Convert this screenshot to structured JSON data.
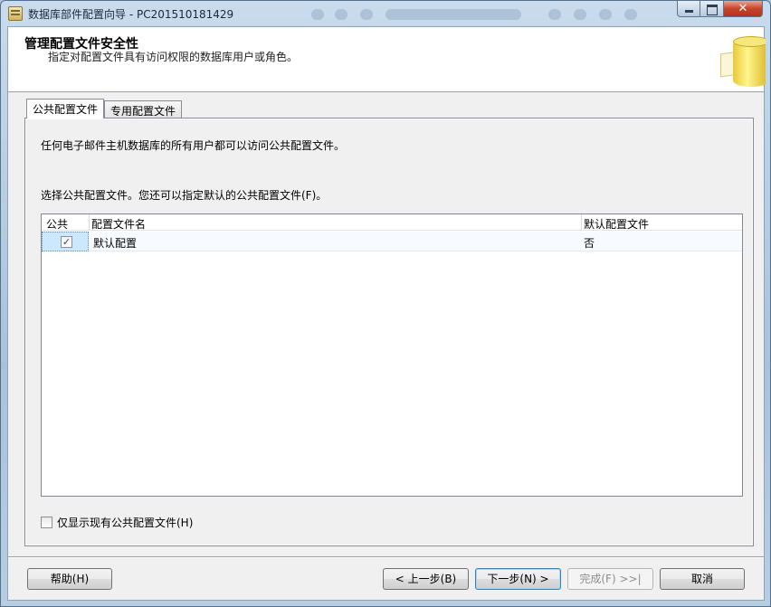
{
  "window": {
    "title": "数据库部件配置向导 - PC201510181429",
    "close_glyph": "✕"
  },
  "header": {
    "title": "管理配置文件安全性",
    "subtitle": "指定对配置文件具有访问权限的数据库用户或角色。"
  },
  "tabs": [
    {
      "label": "公共配置文件",
      "active": true
    },
    {
      "label": "专用配置文件",
      "active": false
    }
  ],
  "panel": {
    "description": "任何电子邮件主机数据库的所有用户都可以访问公共配置文件。",
    "instruction": "选择公共配置文件。您还可以指定默认的公共配置文件(F)。",
    "grid": {
      "columns": [
        "公共",
        "配置文件名",
        "默认配置文件"
      ],
      "rows": [
        {
          "public": true,
          "check_glyph": "✓",
          "name": "默认配置",
          "default": "否"
        }
      ]
    },
    "show_existing_label": "仅显示现有公共配置文件(H)",
    "show_existing_checked": false
  },
  "buttons": {
    "help": "帮助(H)",
    "back": "< 上一步(B)",
    "next": "下一步(N) >",
    "finish": "完成(F) >>|",
    "cancel": "取消"
  }
}
